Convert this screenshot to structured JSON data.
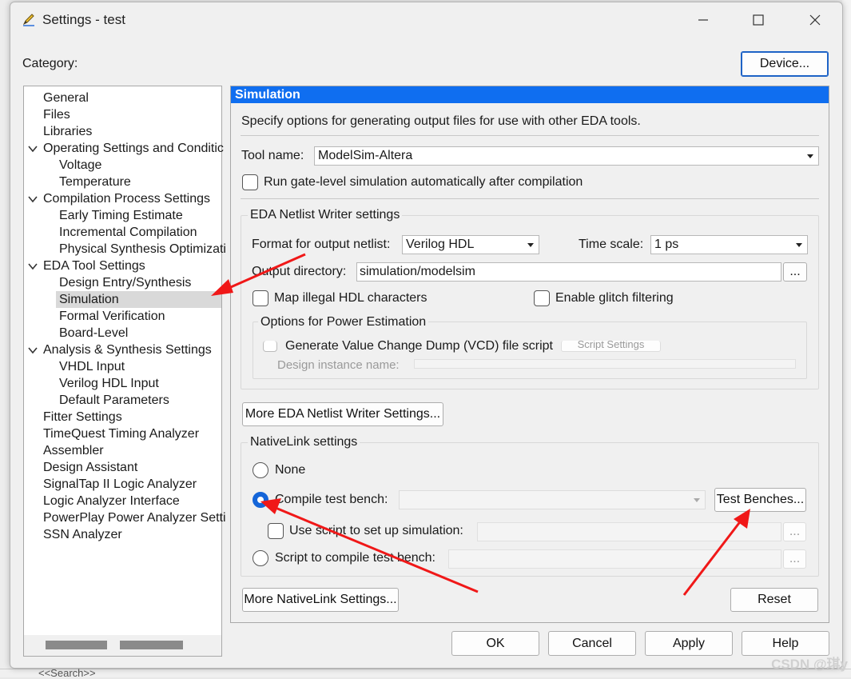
{
  "window": {
    "title": "Settings - test"
  },
  "category_label": "Category:",
  "device_button": "Device...",
  "tree": {
    "items": [
      {
        "label": "General",
        "level": 0
      },
      {
        "label": "Files",
        "level": 0
      },
      {
        "label": "Libraries",
        "level": 0
      },
      {
        "label": "Operating Settings and Conditic",
        "level": 0,
        "expanded": true
      },
      {
        "label": "Voltage",
        "level": 1
      },
      {
        "label": "Temperature",
        "level": 1
      },
      {
        "label": "Compilation Process Settings",
        "level": 0,
        "expanded": true
      },
      {
        "label": "Early Timing Estimate",
        "level": 1
      },
      {
        "label": "Incremental Compilation",
        "level": 1
      },
      {
        "label": "Physical Synthesis Optimizati",
        "level": 1
      },
      {
        "label": "EDA Tool Settings",
        "level": 0,
        "expanded": true
      },
      {
        "label": "Design Entry/Synthesis",
        "level": 1
      },
      {
        "label": "Simulation",
        "level": 1,
        "selected": true
      },
      {
        "label": "Formal Verification",
        "level": 1
      },
      {
        "label": "Board-Level",
        "level": 1
      },
      {
        "label": "Analysis & Synthesis Settings",
        "level": 0,
        "expanded": true
      },
      {
        "label": "VHDL Input",
        "level": 1
      },
      {
        "label": "Verilog HDL Input",
        "level": 1
      },
      {
        "label": "Default Parameters",
        "level": 1
      },
      {
        "label": "Fitter Settings",
        "level": 0
      },
      {
        "label": "TimeQuest Timing Analyzer",
        "level": 0
      },
      {
        "label": "Assembler",
        "level": 0
      },
      {
        "label": "Design Assistant",
        "level": 0
      },
      {
        "label": "SignalTap II Logic Analyzer",
        "level": 0
      },
      {
        "label": "Logic Analyzer Interface",
        "level": 0
      },
      {
        "label": "PowerPlay Power Analyzer Setti",
        "level": 0
      },
      {
        "label": "SSN Analyzer",
        "level": 0
      }
    ]
  },
  "panel": {
    "header": "Simulation",
    "description": "Specify options for generating output files for use with other EDA tools.",
    "tool_name_label": "Tool name:",
    "tool_name_value": "ModelSim-Altera",
    "run_gate_level_label": "Run gate-level simulation automatically after compilation",
    "netlist_group": {
      "title": "EDA Netlist Writer settings",
      "format_label": "Format for output netlist:",
      "format_value": "Verilog HDL",
      "timescale_label": "Time scale:",
      "timescale_value": "1 ps",
      "output_dir_label": "Output directory:",
      "output_dir_value": "simulation/modelsim",
      "browse_label": "...",
      "map_illegal_label": "Map illegal HDL characters",
      "glitch_label": "Enable glitch filtering",
      "power_group": {
        "title": "Options for Power Estimation",
        "vcd_label": "Generate Value Change Dump (VCD) file script",
        "script_settings_label": "Script Settings",
        "design_instance_label": "Design instance name:"
      }
    },
    "more_netlist_button": "More EDA Netlist Writer Settings...",
    "nativelink_group": {
      "title": "NativeLink settings",
      "none_label": "None",
      "compile_tb_label": "Compile test bench:",
      "test_benches_button": "Test Benches...",
      "use_script_label": "Use script to set up simulation:",
      "script_compile_label": "Script to compile test bench:",
      "browse_label": "..."
    },
    "more_nativelink_button": "More NativeLink Settings...",
    "reset_button": "Reset"
  },
  "footer": {
    "ok": "OK",
    "cancel": "Cancel",
    "apply": "Apply",
    "help": "Help"
  },
  "background": {
    "search_hint": "<<Search>>",
    "watermark": "CSDN @琪y"
  },
  "colors": {
    "header_blue": "#0f6ef0",
    "radio_blue": "#1565d8",
    "annotation_red": "#f01818"
  }
}
